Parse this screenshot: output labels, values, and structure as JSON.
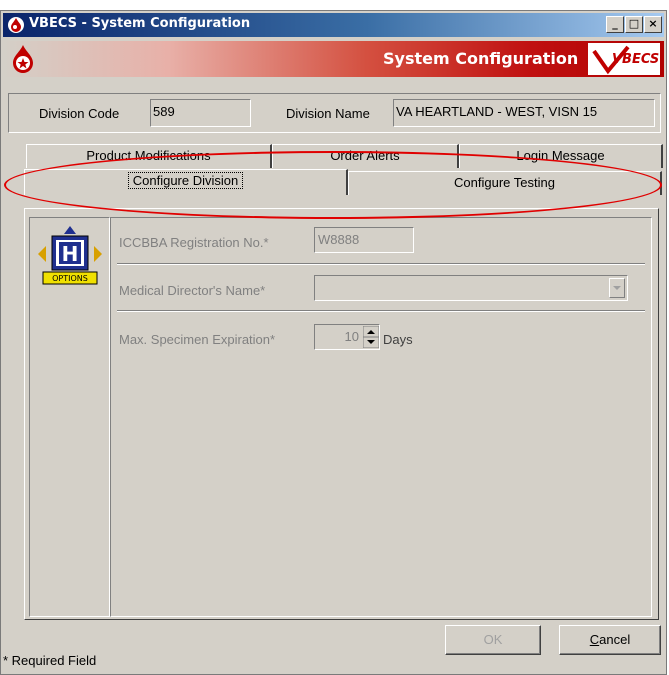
{
  "window": {
    "title": "VBECS - System Configuration",
    "controls": {
      "minimize": "_",
      "maximize": "□",
      "close": "×"
    }
  },
  "banner": {
    "title": "System Configuration",
    "logo_text": "VBECS"
  },
  "division": {
    "code_label": "Division Code",
    "code_value": "589",
    "name_label": "Division Name",
    "name_value": "VA HEARTLAND - WEST, VISN 15"
  },
  "tabs": {
    "row1": [
      {
        "label": "Product Modifications"
      },
      {
        "label": "Order Alerts"
      },
      {
        "label": "Login Message"
      }
    ],
    "row2": [
      {
        "label": "Configure Division",
        "active": true
      },
      {
        "label": "Configure Testing",
        "active": false
      }
    ]
  },
  "options_icon": {
    "letter": "H",
    "label": "OPTIONS"
  },
  "form": {
    "iccbba_label": "ICCBBA Registration No.*",
    "iccbba_value": "W8888",
    "director_label": "Medical Director's Name*",
    "director_value": "",
    "expiration_label": "Max. Specimen Expiration*",
    "expiration_value": "10",
    "expiration_unit": "Days"
  },
  "buttons": {
    "ok": "OK",
    "cancel_prefix": "C",
    "cancel_rest": "ancel"
  },
  "footer": {
    "required_note": "* Required Field"
  },
  "colors": {
    "annotation": "#e00000",
    "titlebar": "#0a246a",
    "banner": "#c01010",
    "window": "#d4d0c8"
  },
  "icons": [
    "vbecs-drop-icon",
    "options-h-icon",
    "dropdown-arrow-icon",
    "spinner-icon"
  ]
}
